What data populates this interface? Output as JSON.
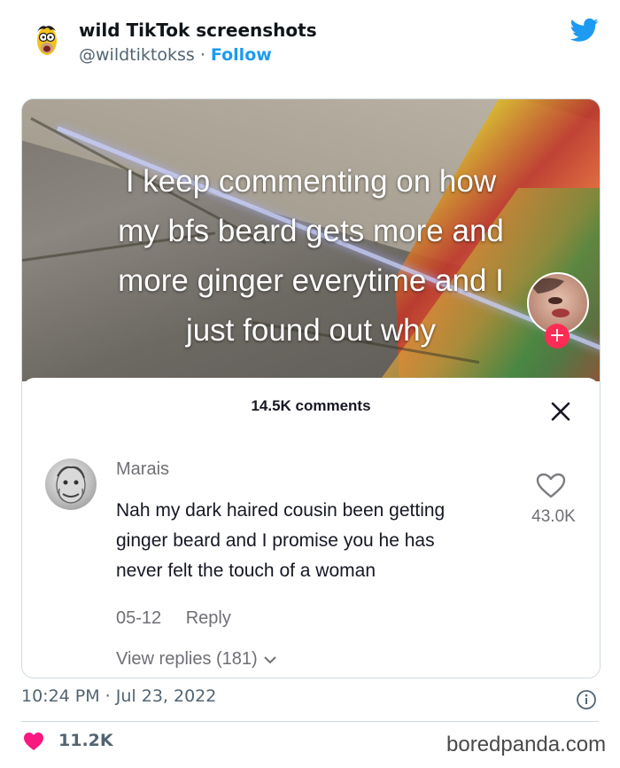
{
  "tweet": {
    "author_name": "wild TikTok screenshots",
    "author_handle": "@wildtiktokss",
    "separator": "·",
    "follow_label": "Follow",
    "timestamp": "10:24 PM · Jul 23, 2022",
    "like_count": "11.2K",
    "twitter_color": "#1d9bf0",
    "like_color": "#f91880"
  },
  "video": {
    "caption_lines": [
      "I keep commenting on how",
      "my bfs beard gets more and",
      "more ginger everytime and I",
      "just found out why"
    ],
    "plus_icon": "+"
  },
  "comments_panel": {
    "count_label": "14.5K comments",
    "close_icon": "close-icon",
    "comment": {
      "author": "Marais",
      "text_lines": [
        "Nah my dark haired cousin been getting",
        "ginger beard and I promise you he has",
        "never felt the touch of a woman"
      ],
      "likes": "43.0K",
      "date": "05-12",
      "reply_label": "Reply",
      "view_replies_label": "View replies (181)"
    }
  },
  "watermark": "boredpanda.com"
}
